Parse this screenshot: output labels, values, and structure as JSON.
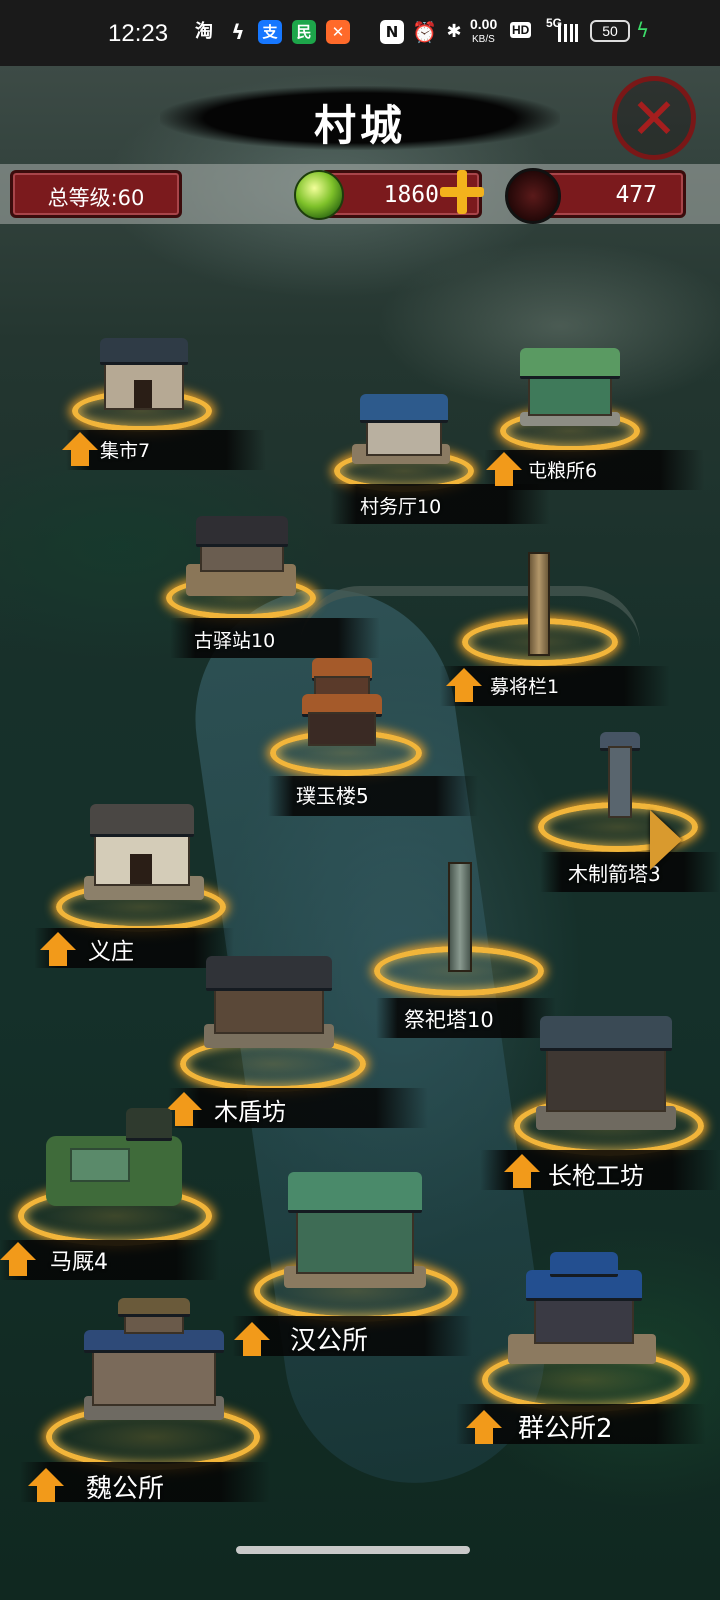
{
  "status_bar": {
    "time": "12:23",
    "app_icons": [
      "taobao-icon",
      "lightning-app-icon",
      "alipay-icon",
      "green-app-icon",
      "orange-app-icon"
    ],
    "nfc": "N",
    "net_speed_value": "0.00",
    "net_speed_unit": "KB/S",
    "hd": "HD",
    "signal": "5G",
    "battery": "50"
  },
  "header": {
    "title": "村城",
    "close_icon": "close-icon"
  },
  "resources": {
    "total_level_label": "总等级:60",
    "jade": "1860",
    "token": "477"
  },
  "buildings": [
    {
      "id": "market",
      "label": "集市7",
      "upgradable": true
    },
    {
      "id": "village-hall",
      "label": "村务厅10",
      "upgradable": false
    },
    {
      "id": "granary",
      "label": "屯粮所6",
      "upgradable": true
    },
    {
      "id": "post-station",
      "label": "古驿站10",
      "upgradable": false
    },
    {
      "id": "recruit-hall",
      "label": "募将栏1",
      "upgradable": true
    },
    {
      "id": "jade-tower",
      "label": "璞玉楼5",
      "upgradable": false
    },
    {
      "id": "arrow-tower",
      "label": "木制箭塔3",
      "upgradable": false
    },
    {
      "id": "charity-manor",
      "label": "义庄",
      "upgradable": true
    },
    {
      "id": "sacrifice-tower",
      "label": "祭祀塔10",
      "upgradable": false
    },
    {
      "id": "shield-workshop",
      "label": "木盾坊",
      "upgradable": true
    },
    {
      "id": "spear-workshop",
      "label": "长枪工坊",
      "upgradable": true
    },
    {
      "id": "stable",
      "label": "马厩4",
      "upgradable": true
    },
    {
      "id": "han-office",
      "label": "汉公所",
      "upgradable": true
    },
    {
      "id": "qun-office",
      "label": "群公所2",
      "upgradable": true
    },
    {
      "id": "wei-office",
      "label": "魏公所",
      "upgradable": true
    }
  ]
}
